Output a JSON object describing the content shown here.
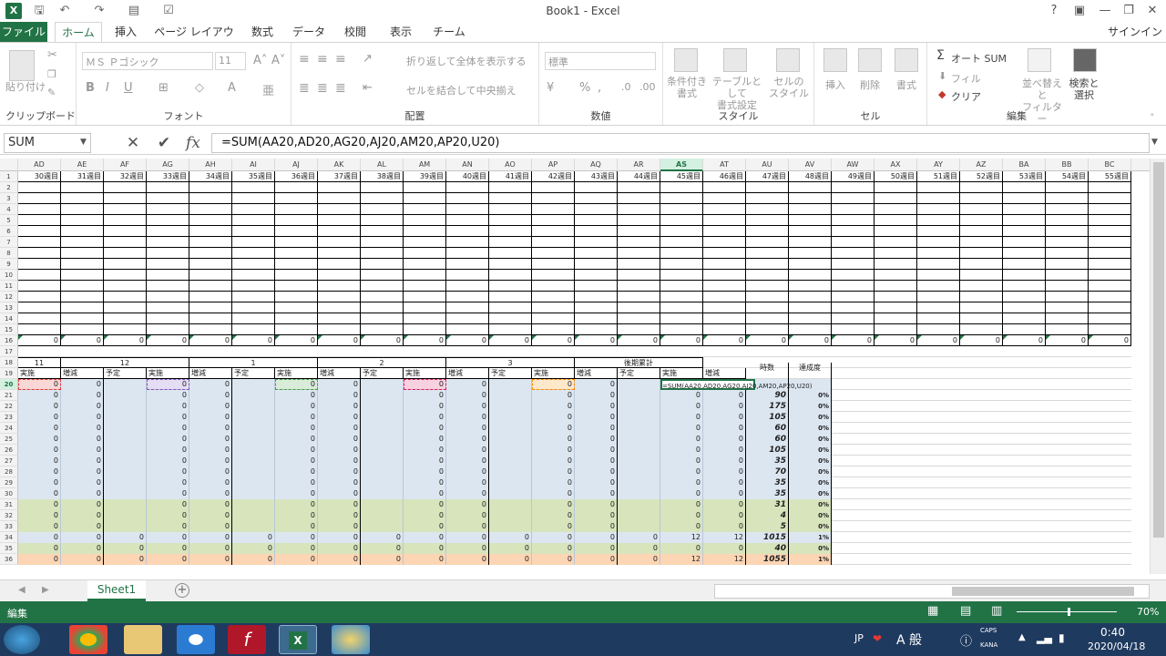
{
  "window": {
    "title": "Book1 - Excel",
    "help": "?"
  },
  "tabs": [
    "ファイル",
    "ホーム",
    "挿入",
    "ページ レイアウト",
    "数式",
    "データ",
    "校閲",
    "表示",
    "チーム"
  ],
  "signin": "サインイン",
  "ribbon": {
    "clipboard": {
      "paste": "貼り付け",
      "label": "クリップボード"
    },
    "font": {
      "name": "ＭＳ Ｐゴシック",
      "size": "11",
      "label": "フォント",
      "bold": "B",
      "italic": "I",
      "underline": "U"
    },
    "align": {
      "wrap": "折り返して全体を表示する",
      "merge": "セルを結合して中央揃え",
      "label": "配置"
    },
    "number": {
      "format": "標準",
      "label": "数値"
    },
    "styles": {
      "cond": "条件付き\n書式",
      "table": "テーブルとして\n書式設定",
      "cell": "セルの\nスタイル",
      "label": "スタイル"
    },
    "cells": {
      "insert": "挿入",
      "delete": "削除",
      "format": "書式",
      "label": "セル"
    },
    "edit": {
      "autosum": "オート SUM",
      "fill": "フィル",
      "clear": "クリア",
      "sort": "並べ替えと\nフィルター",
      "find": "検索と\n選択",
      "label": "編集"
    }
  },
  "formula_bar": {
    "name_box": "SUM",
    "formula": "=SUM(AA20,AD20,AG20,AJ20,AM20,AP20,U20)",
    "fx": "fx"
  },
  "columns": [
    "AD",
    "AE",
    "AF",
    "AG",
    "AH",
    "AI",
    "AJ",
    "AK",
    "AL",
    "AM",
    "AN",
    "AO",
    "AP",
    "AQ",
    "AR",
    "AS",
    "AT",
    "AU",
    "AV",
    "AW",
    "AX",
    "AY",
    "AZ",
    "BA",
    "BB",
    "BC"
  ],
  "selected_column": "AS",
  "row1_weeks": [
    "30週目",
    "31週目",
    "32週目",
    "33週目",
    "34週目",
    "35週目",
    "36週目",
    "37週目",
    "38週目",
    "39週目",
    "40週目",
    "41週目",
    "42週目",
    "43週目",
    "44週目",
    "45週目",
    "46週目",
    "47週目",
    "48週目",
    "49週目",
    "50週目",
    "51週目",
    "52週目",
    "53週目",
    "54週目",
    "55週目"
  ],
  "row16_values": [
    "0",
    "0",
    "0",
    "0",
    "0",
    "0",
    "0",
    "0",
    "0",
    "0",
    "0",
    "0",
    "0",
    "0",
    "0",
    "0",
    "0",
    "0",
    "0",
    "0",
    "0",
    "0",
    "0",
    "0",
    "0",
    "0"
  ],
  "month_headers": [
    "11",
    "12",
    "1",
    "2",
    "3",
    "後期累計",
    "時数",
    "達成度"
  ],
  "sub_headers": [
    "実施",
    "増減",
    "予定",
    "実施",
    "増減",
    "予定",
    "実施",
    "増減",
    "予定",
    "実施",
    "増減",
    "予定",
    "実施",
    "増減",
    "予定",
    "実施",
    "増減"
  ],
  "editing_cell_text": "=SUM(AA20,AD20,AG20,AJ20,AM20,AP20,U20)",
  "hours": [
    "",
    "90",
    "175",
    "105",
    "60",
    "60",
    "105",
    "35",
    "70",
    "35",
    "35",
    "31",
    "4",
    "5",
    "1015",
    "40",
    "1055"
  ],
  "achievement": [
    "",
    "0%",
    "0%",
    "0%",
    "0%",
    "0%",
    "0%",
    "0%",
    "0%",
    "0%",
    "0%",
    "0%",
    "0%",
    "0%",
    "1%",
    "0%",
    "1%"
  ],
  "row34": {
    "cumulative_done": "12",
    "cumulative_diff": "12"
  },
  "row36": {
    "cumulative_done": "12",
    "cumulative_diff": "12"
  },
  "sheet": {
    "name": "Sheet1",
    "add": "+"
  },
  "status": {
    "mode": "編集",
    "zoom": "70%"
  },
  "taskbar": {
    "time": "0:40",
    "date": "2020/04/18",
    "ime_lang": "JP",
    "ime_mode": "A 般",
    "caps": "CAPS",
    "kana": "KANA"
  },
  "colors": {
    "excel_green": "#217346",
    "row_blue": "#dce6f1",
    "row_green": "#d8e4bc",
    "row_orange": "#fcd5b4"
  }
}
